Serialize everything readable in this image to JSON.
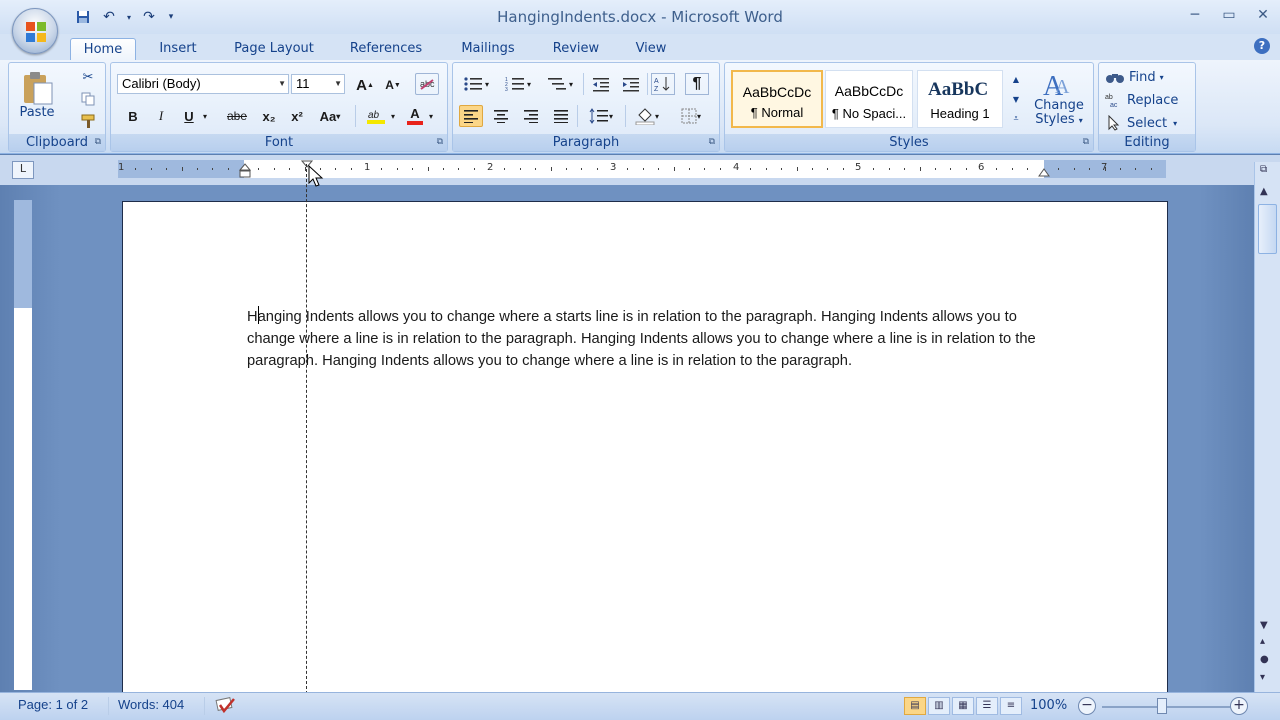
{
  "window": {
    "title": "HangingIndents.docx - Microsoft Word"
  },
  "window_controls": {
    "minimize": "─",
    "maximize": "▭",
    "close": "✕"
  },
  "tabs": [
    {
      "label": "Home",
      "active": true
    },
    {
      "label": "Insert"
    },
    {
      "label": "Page Layout"
    },
    {
      "label": "References"
    },
    {
      "label": "Mailings"
    },
    {
      "label": "Review"
    },
    {
      "label": "View"
    }
  ],
  "help": "?",
  "clipboard": {
    "label": "Clipboard",
    "paste": "Paste"
  },
  "font": {
    "label": "Font",
    "name": "Calibri (Body)",
    "size": "11",
    "bold": "B",
    "italic": "I",
    "underline": "U",
    "strike": "abe",
    "subscript": "x₂",
    "superscript": "x²",
    "case": "Aa",
    "grow": "A",
    "shrink": "A",
    "color_a": "A"
  },
  "paragraph": {
    "label": "Paragraph",
    "show_marks": "¶"
  },
  "styles": {
    "label": "Styles",
    "items": [
      {
        "preview": "AaBbCcDc",
        "name": "¶ Normal",
        "selected": true
      },
      {
        "preview": "AaBbCcDc",
        "name": "¶ No Spaci..."
      },
      {
        "preview": "AaBbC ",
        "name": "Heading 1"
      }
    ],
    "change_styles_line1": "Change",
    "change_styles_line2": "Styles"
  },
  "editing": {
    "label": "Editing",
    "find": "Find",
    "replace": "Replace",
    "select": "Select"
  },
  "ruler": {
    "tab_selector": "L",
    "numbers": [
      "1",
      "1",
      "2",
      "3",
      "4",
      "5",
      "6",
      "7"
    ]
  },
  "document": {
    "text": "Hanging Indents allows you to change where a  starts line  is in relation to the paragraph. Hanging Indents allows you to change where a line is  in relation to the paragraph. Hanging Indents allows you to change where a line is in  relation to the paragraph. Hanging Indents allows you to change where a line  is in relation to the paragraph."
  },
  "status": {
    "page": "Page: 1 of 2",
    "words": "Words: 404",
    "zoom": "100%"
  }
}
